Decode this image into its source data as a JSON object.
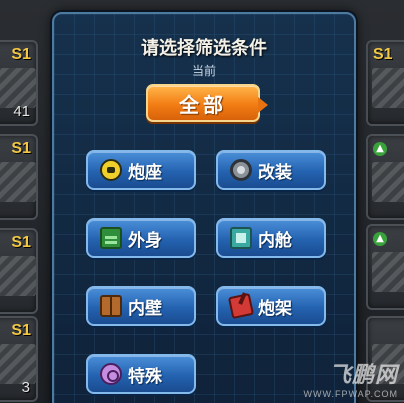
{
  "dialog": {
    "title": "请选择筛选条件",
    "current_label": "当前",
    "current_value": "全部"
  },
  "filters": [
    {
      "label": "炮座",
      "icon": "turret-mount-icon"
    },
    {
      "label": "改装",
      "icon": "gear-icon"
    },
    {
      "label": "外身",
      "icon": "hull-exterior-icon"
    },
    {
      "label": "内舱",
      "icon": "cabin-icon"
    },
    {
      "label": "内壁",
      "icon": "inner-wall-icon"
    },
    {
      "label": "炮架",
      "icon": "gun-carriage-icon"
    },
    {
      "label": "特殊",
      "icon": "special-icon"
    }
  ],
  "inventory": {
    "left_slots": [
      {
        "tier": "S1",
        "count": "41"
      },
      {
        "tier": "S1",
        "count": ""
      },
      {
        "tier": "S1",
        "count": ""
      },
      {
        "tier": "S1",
        "count": "3"
      }
    ],
    "right_slots": [
      {
        "tier": "S1",
        "count": ""
      },
      {
        "tier": "",
        "count": ""
      },
      {
        "tier": "",
        "count": ""
      },
      {
        "tier": "",
        "count": ""
      }
    ]
  },
  "watermark": {
    "text": "飞鹏网",
    "url": "WWW.FPWAP.COM"
  },
  "colors": {
    "panel_bg": "#16314d",
    "accent_orange": "#f27d14",
    "button_blue": "#2462b0",
    "tier_gold": "#f2c744"
  }
}
